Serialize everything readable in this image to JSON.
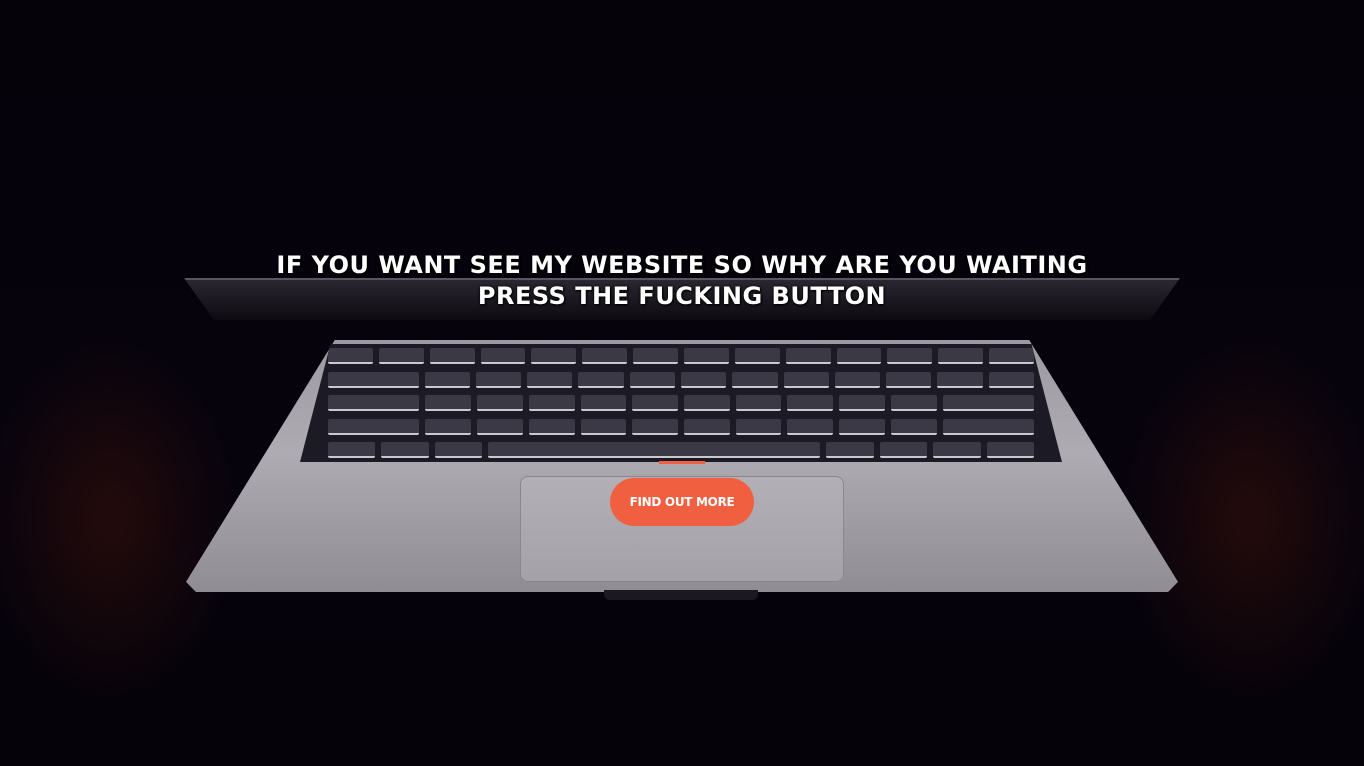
{
  "hero": {
    "headline_line1": "IF YOU WANT SEE MY WEBSITE SO WHY ARE YOU WAITING",
    "headline_line2": "PRESS THE FUCKING BUTTON",
    "cta_label": "FIND OUT MORE"
  },
  "colors": {
    "accent": "#f05f40",
    "background": "#06030c",
    "headline_text": "#ffffff"
  },
  "background_image": "laptop-keyboard-photo"
}
